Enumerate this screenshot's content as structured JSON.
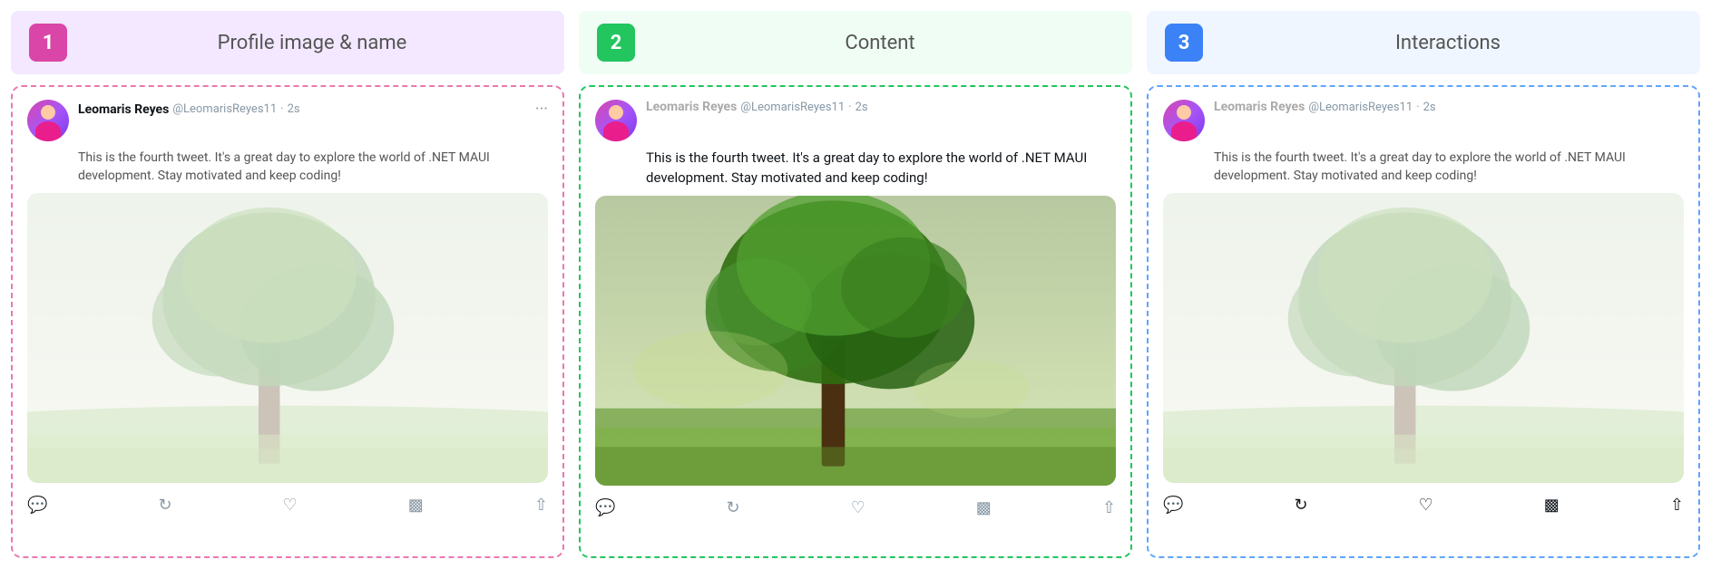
{
  "columns": [
    {
      "id": "col1",
      "number": "1",
      "title": "Profile image & name",
      "border_color": "pink",
      "author_name": "Leomaris Reyes",
      "author_handle": "@LeomarisReyes11",
      "time": "2s",
      "tweet_text": "This is the fourth tweet. It's a great day to explore the world of .NET MAUI development. Stay motivated and keep coding!",
      "name_style": "bold",
      "text_style": "dimmed",
      "actions_style": "dimmed",
      "image_opacity": "dimmed"
    },
    {
      "id": "col2",
      "number": "2",
      "title": "Content",
      "border_color": "green",
      "author_name": "Leomaris Reyes",
      "author_handle": "@LeomarisReyes11",
      "time": "2s",
      "tweet_text": "This is the fourth tweet. It's a great day to explore the world of .NET MAUI development. Stay motivated and keep coding!",
      "name_style": "dimmed",
      "text_style": "active",
      "actions_style": "dimmed",
      "image_opacity": "normal"
    },
    {
      "id": "col3",
      "number": "3",
      "title": "Interactions",
      "border_color": "blue",
      "author_name": "Leomaris Reyes",
      "author_handle": "@LeomarisReyes11",
      "time": "2s",
      "tweet_text": "This is the fourth tweet. It's a great day to explore the world of .NET MAUI development. Stay motivated and keep coding!",
      "name_style": "dimmed",
      "text_style": "dimmed",
      "actions_style": "active",
      "image_opacity": "dimmed"
    }
  ],
  "actions": [
    "comment",
    "retweet",
    "like",
    "stats",
    "share"
  ],
  "dot_separator": "·"
}
